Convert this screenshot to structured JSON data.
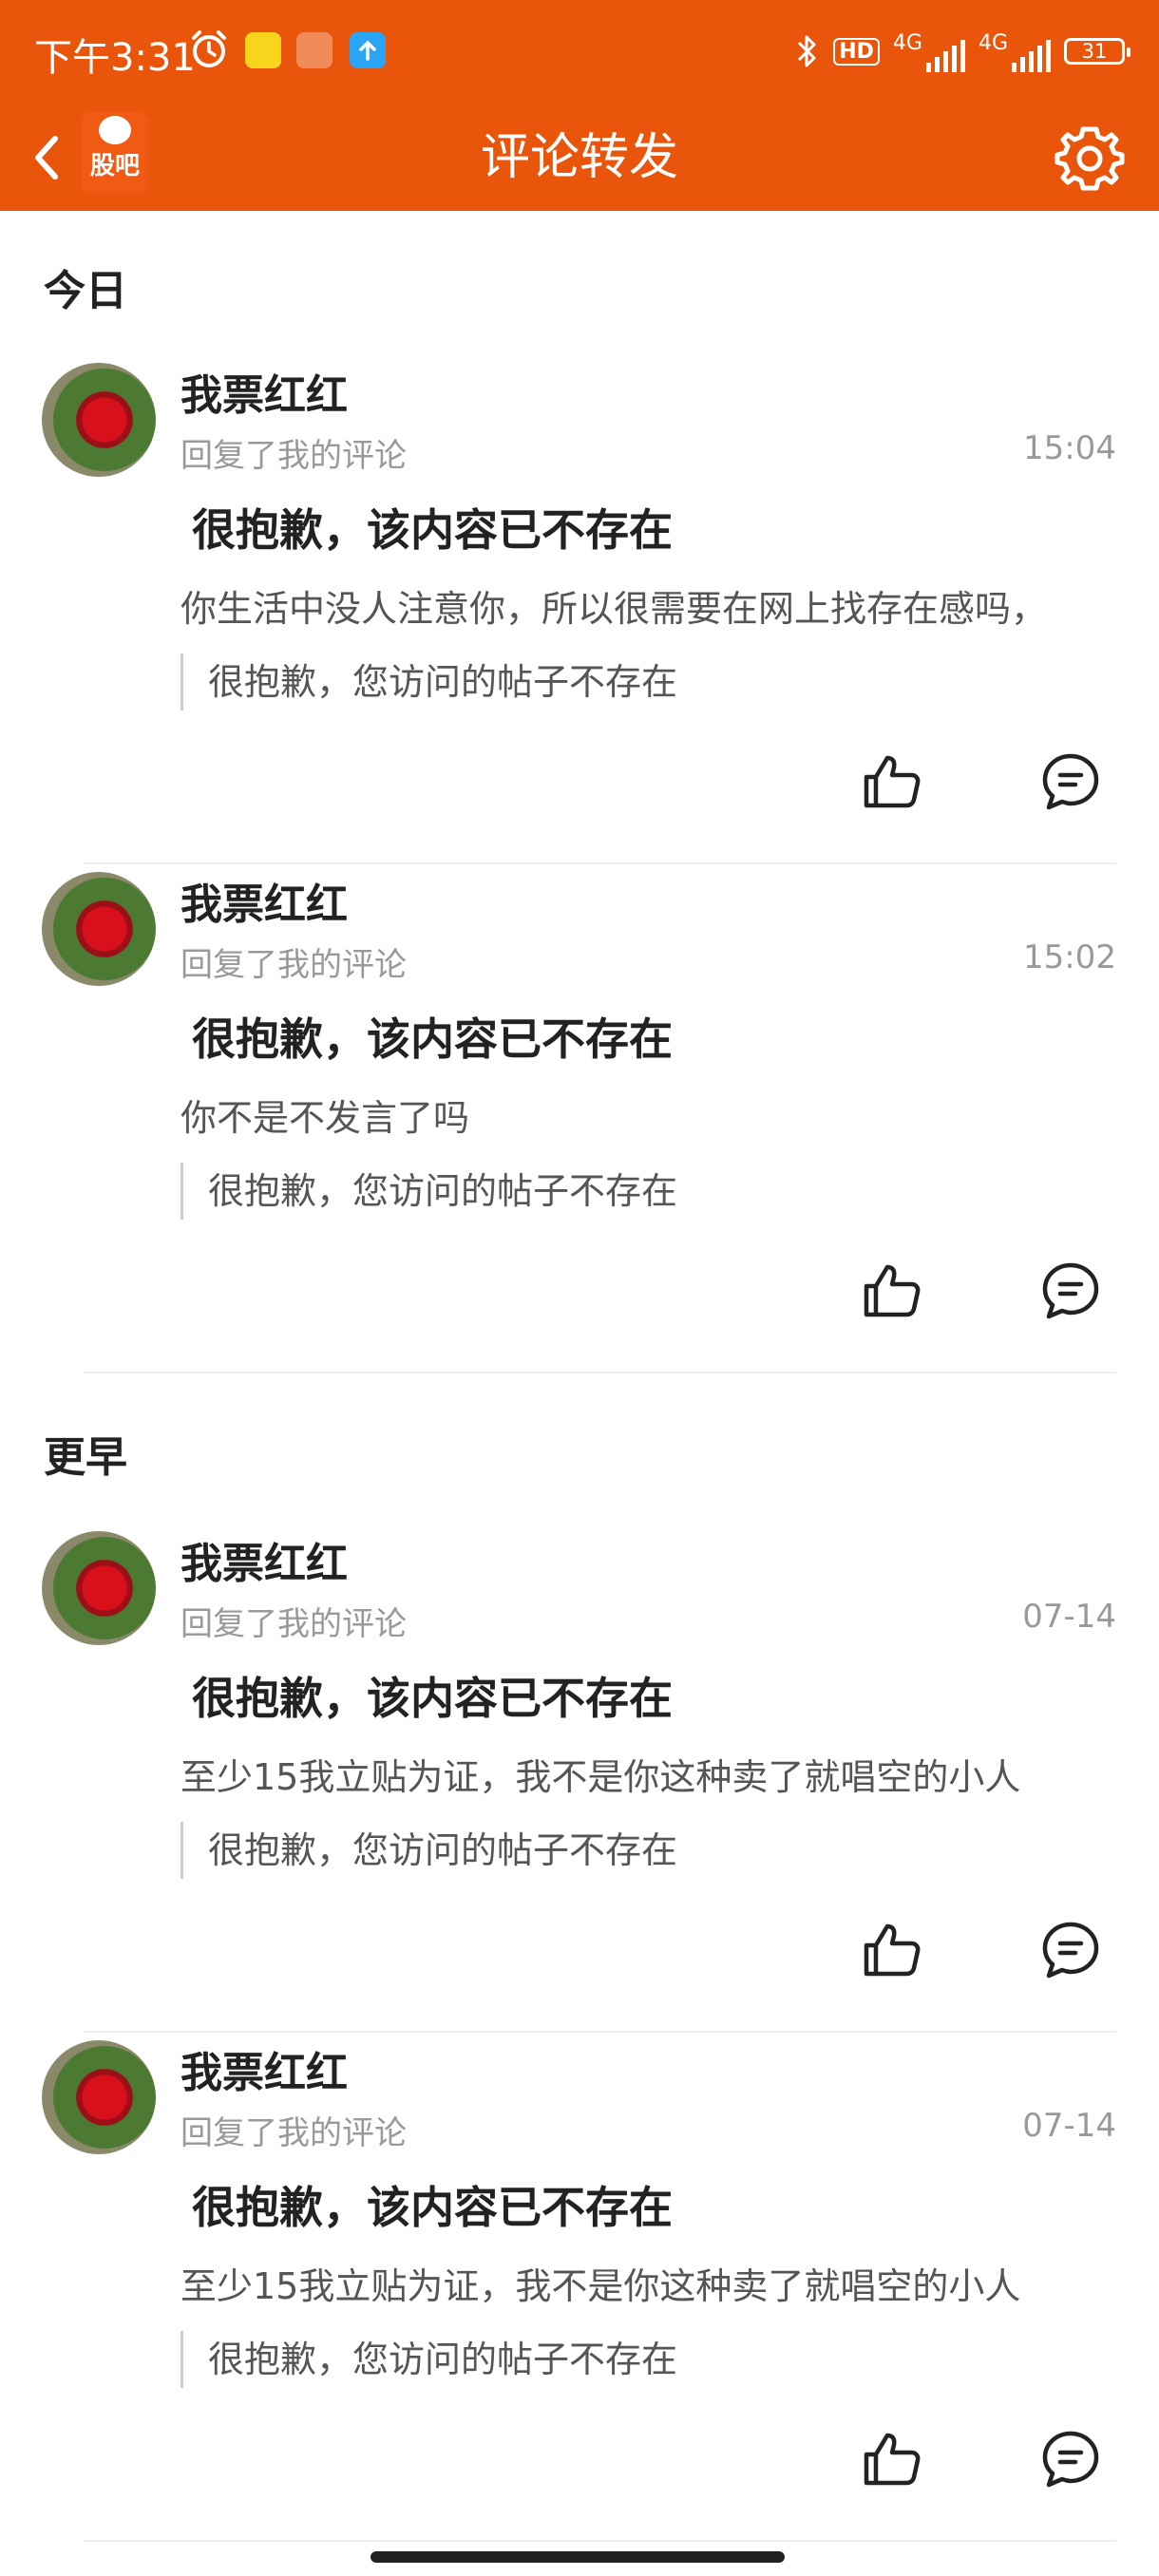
{
  "status_bar": {
    "time": "下午3:31",
    "icons": [
      "alarm-icon",
      "app-icon-yellow",
      "app-icon-orange",
      "app-icon-blue",
      "bluetooth-icon",
      "hd-icon",
      "signal-4g-icon",
      "signal-4g-icon"
    ],
    "hd_label": "HD",
    "net1": "4G",
    "net2": "4G",
    "battery": "31"
  },
  "nav": {
    "logo_text": "股吧",
    "title": "评论转发"
  },
  "sections": {
    "today": "今日",
    "earlier": "更早"
  },
  "items": [
    {
      "username": "我票红红",
      "subtitle": "回复了我的评论",
      "time": "15:04",
      "notice": "很抱歉，该内容已不存在",
      "reply": "你生活中没人注意你，所以很需要在网上找存在感吗，",
      "quote": "很抱歉，您访问的帖子不存在"
    },
    {
      "username": "我票红红",
      "subtitle": "回复了我的评论",
      "time": "15:02",
      "notice": "很抱歉，该内容已不存在",
      "reply": "你不是不发言了吗",
      "quote": "很抱歉，您访问的帖子不存在"
    },
    {
      "username": "我票红红",
      "subtitle": "回复了我的评论",
      "time": "07-14",
      "notice": "很抱歉，该内容已不存在",
      "reply": "至少15我立贴为证，我不是你这种卖了就唱空的小人",
      "quote": "很抱歉，您访问的帖子不存在"
    },
    {
      "username": "我票红红",
      "subtitle": "回复了我的评论",
      "time": "07-14",
      "notice": "很抱歉，该内容已不存在",
      "reply": "至少15我立贴为证，我不是你这种卖了就唱空的小人",
      "quote": "很抱歉，您访问的帖子不存在"
    }
  ],
  "colors": {
    "brand": "#E9550A",
    "text": "#222222",
    "secondary": "#999999"
  }
}
